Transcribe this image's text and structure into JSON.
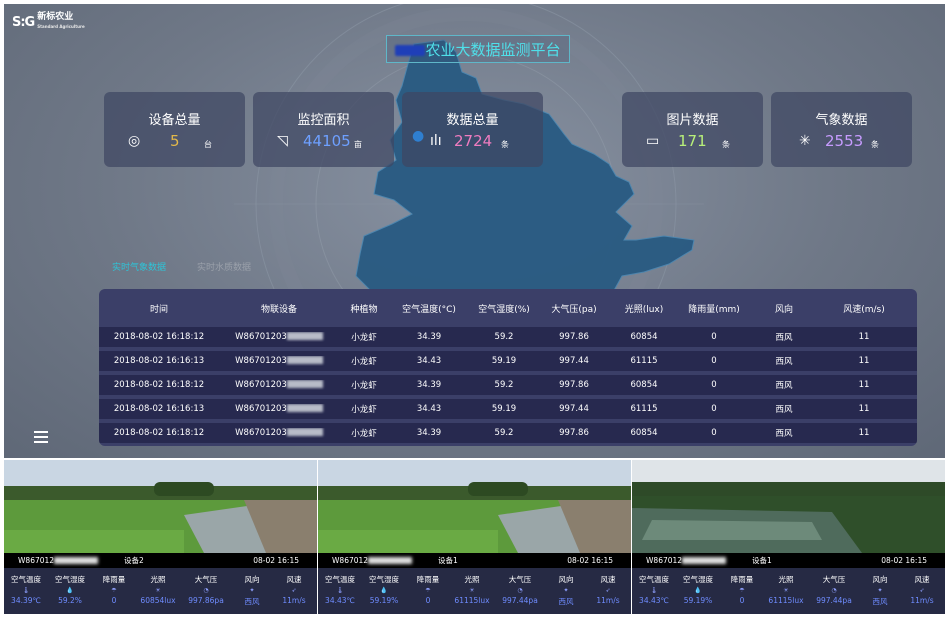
{
  "header": {
    "logo_mark": "S:G",
    "logo_text": "新标农业",
    "logo_sub": "Standard Agriculture",
    "title": "农业大数据监测平台"
  },
  "stats": [
    {
      "label": "设备总量",
      "value": "5",
      "unit": "台",
      "icon": "device-icon",
      "color": "#e2b84a"
    },
    {
      "label": "监控面积",
      "value": "44105",
      "unit": "亩",
      "icon": "area-icon",
      "color": "#6ea0ff"
    },
    {
      "label": "数据总量",
      "value": "2724",
      "unit": "条",
      "icon": "bar-chart-icon",
      "color": "#f07cc0"
    },
    {
      "label": "图片数据",
      "value": "171",
      "unit": "条",
      "icon": "image-icon",
      "color": "#b8f07a"
    },
    {
      "label": "气象数据",
      "value": "2553",
      "unit": "条",
      "icon": "weather-icon",
      "color": "#c79cff"
    }
  ],
  "tabs": {
    "weather": "实时气象数据",
    "water": "实时水质数据"
  },
  "table": {
    "headers": [
      "时间",
      "物联设备",
      "种植物",
      "空气温度(°C)",
      "空气湿度(%)",
      "大气压(pa)",
      "光照(lux)",
      "降雨量(mm)",
      "风向",
      "风速(m/s)"
    ],
    "rows": [
      [
        "2018-08-02 16:18:12",
        "W86701203",
        "小龙虾",
        "34.39",
        "59.2",
        "997.86",
        "60854",
        "0",
        "西风",
        "11"
      ],
      [
        "2018-08-02 16:16:13",
        "W86701203",
        "小龙虾",
        "34.43",
        "59.19",
        "997.44",
        "61115",
        "0",
        "西风",
        "11"
      ],
      [
        "2018-08-02 16:18:12",
        "W86701203",
        "小龙虾",
        "34.39",
        "59.2",
        "997.86",
        "60854",
        "0",
        "西风",
        "11"
      ],
      [
        "2018-08-02 16:16:13",
        "W86701203",
        "小龙虾",
        "34.43",
        "59.19",
        "997.44",
        "61115",
        "0",
        "西风",
        "11"
      ],
      [
        "2018-08-02 16:18:12",
        "W86701203",
        "小龙虾",
        "34.39",
        "59.2",
        "997.86",
        "60854",
        "0",
        "西风",
        "11"
      ]
    ]
  },
  "metric_labels": [
    "空气温度",
    "空气湿度",
    "降雨量",
    "光照",
    "大气压",
    "风向",
    "风速"
  ],
  "cameras": [
    {
      "device": "W867012",
      "name": "设备2",
      "time": "08-02 16:15",
      "values": [
        "34.39℃",
        "59.2%",
        "0",
        "60854lux",
        "997.86pa",
        "西风",
        "11m/s"
      ]
    },
    {
      "device": "W867012",
      "name": "设备1",
      "time": "08-02 16:15",
      "values": [
        "34.43℃",
        "59.19%",
        "0",
        "61115lux",
        "997.44pa",
        "西风",
        "11m/s"
      ]
    },
    {
      "device": "W867012",
      "name": "设备1",
      "time": "08-02 16:15",
      "values": [
        "34.43℃",
        "59.19%",
        "0",
        "61115lux",
        "997.44pa",
        "西风",
        "11m/s"
      ]
    }
  ]
}
